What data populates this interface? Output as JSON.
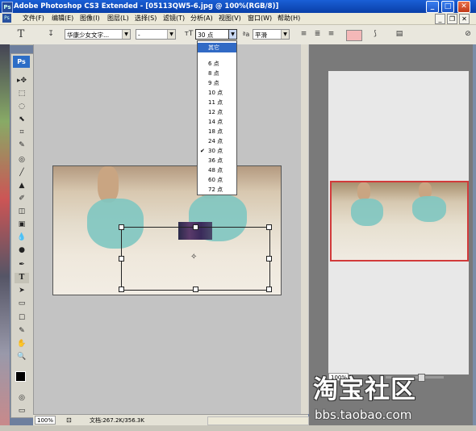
{
  "window": {
    "app_icon": "Ps",
    "title": "Adobe Photoshop CS3 Extended - [05113QW5-6.jpg @ 100%(RGB/8)]",
    "controls": [
      "_",
      "□",
      "✕"
    ]
  },
  "menubar": {
    "items": [
      "文件(F)",
      "编辑(E)",
      "图像(I)",
      "图层(L)",
      "选择(S)",
      "滤镜(T)",
      "分析(A)",
      "视图(V)",
      "窗口(W)",
      "帮助(H)"
    ],
    "doc_controls": [
      "_",
      "❐",
      "✕"
    ]
  },
  "options_bar": {
    "tool_glyph": "T",
    "font_family": "华康少女文字...",
    "font_style": "-",
    "font_size": "30 点",
    "antialias": "平滑",
    "swatch_color": "#f4b8b8"
  },
  "font_size_dropdown": {
    "options": [
      "其它",
      "6 点",
      "8 点",
      "9 点",
      "10 点",
      "11 点",
      "12 点",
      "14 点",
      "18 点",
      "24 点",
      "30 点",
      "36 点",
      "48 点",
      "60 点",
      "72 点"
    ],
    "highlighted": "其它",
    "checked": "30 点"
  },
  "toolbox": {
    "header": "Ps",
    "tools": [
      "▸✥",
      "⬚",
      "◌",
      "⬉",
      "⌗",
      "✎",
      "◎",
      "╱",
      "▲",
      "✐",
      "◫",
      "▣",
      "💧",
      "●",
      "✒",
      "T",
      "➤",
      "▭",
      "☐",
      "✎",
      "✋",
      "🔍",
      "■",
      "◎",
      "▭"
    ]
  },
  "status_bar": {
    "zoom": "100%",
    "doc_info": "文档:267.2K/356.3K"
  },
  "navigator": {
    "zoom": "100%",
    "zoom_fraction": 0.6
  },
  "watermark": {
    "logo_text": "淘宝社区",
    "url": "bbs.taobao.com"
  }
}
